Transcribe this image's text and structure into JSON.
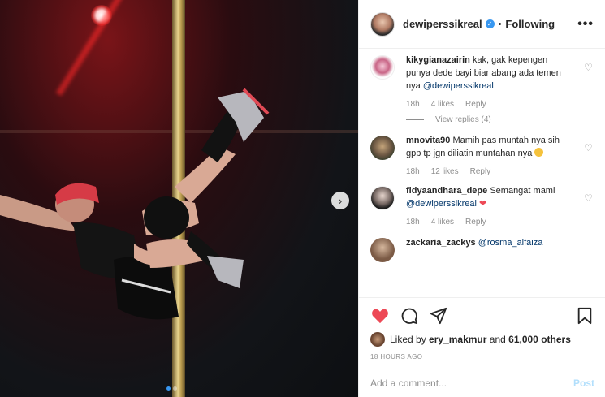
{
  "post": {
    "username": "dewiperssikreal",
    "separator": "•",
    "follow_status": "Following",
    "more_icon": "•••"
  },
  "comments": [
    {
      "author": "kikygianazairin",
      "text": "kak, gak kepengen punya dede bayi biar abang ada temen nya",
      "mention": "@dewiperssikreal",
      "time": "18h",
      "likes": "4 likes",
      "reply": "Reply",
      "view_replies": "View replies (4)"
    },
    {
      "author": "mnovita90",
      "text": "Mamih pas muntah nya sih gpp tp jgn diliatin muntahan nya",
      "time": "18h",
      "likes": "12 likes",
      "reply": "Reply"
    },
    {
      "author": "fidyaandhara_depe",
      "text": "Semangat mami",
      "mention": "@dewiperssikreal",
      "time": "18h",
      "likes": "4 likes",
      "reply": "Reply"
    },
    {
      "author": "zackaria_zackys",
      "mention": "@rosma_alfaiza"
    }
  ],
  "likes_summary": {
    "prefix": "Liked by",
    "user": "ery_makmur",
    "and": "and",
    "count": "61,000 others"
  },
  "timestamp": "18 HOURS AGO",
  "comment_box": {
    "placeholder": "Add a comment...",
    "post_label": "Post"
  },
  "colors": {
    "accent": "#3897f0",
    "like_red": "#ed4956",
    "muted": "#8e8e8e",
    "post_disabled": "#b2dffc"
  }
}
